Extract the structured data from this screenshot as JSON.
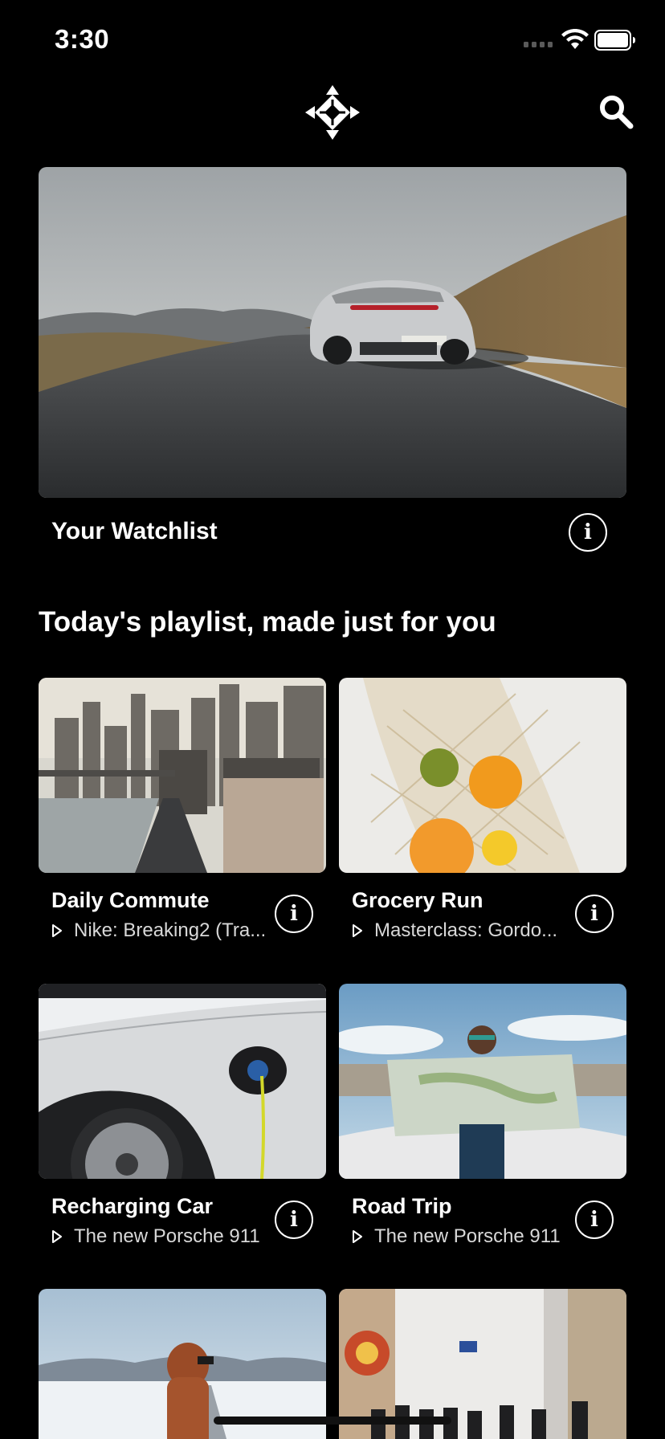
{
  "status_bar": {
    "time": "3:30"
  },
  "icons": {
    "logo": "app-logo-icon",
    "search": "search-icon",
    "info": "info-icon",
    "play": "play-icon",
    "wifi": "wifi-icon",
    "battery": "battery-icon",
    "signal": "signal-icon"
  },
  "hero": {
    "label": "Your Watchlist"
  },
  "section": {
    "title": "Today's playlist, made just for you"
  },
  "cards": [
    {
      "title": "Daily Commute",
      "subtitle": "Nike: Breaking2 (Tra..."
    },
    {
      "title": "Grocery Run",
      "subtitle": "Masterclass: Gordo..."
    },
    {
      "title": "Recharging Car",
      "subtitle": "The new Porsche 911"
    },
    {
      "title": "Road Trip",
      "subtitle": "The new Porsche 911"
    },
    {
      "title": "",
      "subtitle": ""
    },
    {
      "title": "",
      "subtitle": ""
    }
  ],
  "info_glyph": "i"
}
